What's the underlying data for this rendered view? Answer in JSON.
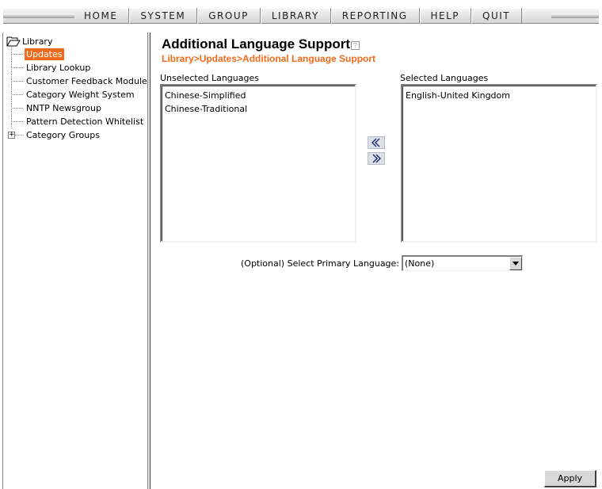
{
  "nav": {
    "items": [
      "HOME",
      "SYSTEM",
      "GROUP",
      "LIBRARY",
      "REPORTING",
      "HELP",
      "QUIT"
    ]
  },
  "sidebar": {
    "root_label": "Library",
    "items": [
      {
        "label": "Updates",
        "selected": true
      },
      {
        "label": "Library Lookup"
      },
      {
        "label": "Customer Feedback Module"
      },
      {
        "label": "Category Weight System"
      },
      {
        "label": "NNTP Newsgroup"
      },
      {
        "label": "Pattern Detection Whitelist"
      },
      {
        "label": "Category Groups",
        "expander": "+"
      }
    ]
  },
  "main": {
    "title": "Additional Language Support",
    "breadcrumb": "Library>Updates>Additional Language Support",
    "unselected_label": "Unselected Languages",
    "selected_label": "Selected Languages",
    "unselected_languages": [
      "Chinese-Simplified",
      "Chinese-Traditional"
    ],
    "selected_languages": [
      "English-United Kingdom"
    ],
    "primary_language_label": "(Optional) Select Primary Language:",
    "primary_language_value": "(None)",
    "apply_label": "Apply"
  },
  "colors": {
    "accent": "#f26a1b"
  },
  "icons": {
    "help": "help-icon",
    "move_left": "double-chevron-left-icon",
    "move_right": "double-chevron-right-icon",
    "dropdown": "triangle-down-icon",
    "root_folder": "open-folder-icon"
  }
}
